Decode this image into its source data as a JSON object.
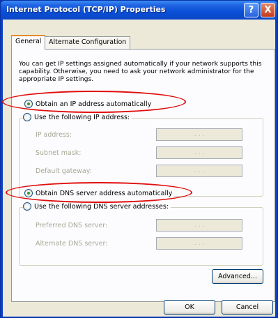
{
  "window": {
    "title": "Internet Protocol (TCP/IP) Properties",
    "help_label": "?",
    "close_label": "X"
  },
  "tabs": [
    {
      "label": "General",
      "active": true
    },
    {
      "label": "Alternate Configuration",
      "active": false
    }
  ],
  "general": {
    "description": "You can get IP settings assigned automatically if your network supports this capability. Otherwise, you need to ask your network administrator for the appropriate IP settings.",
    "ip": {
      "auto_label": "Obtain an IP address automatically",
      "auto_checked": true,
      "manual_label": "Use the following IP address:",
      "manual_checked": false,
      "fields": [
        {
          "label": "IP address:",
          "value": ". . ."
        },
        {
          "label": "Subnet mask:",
          "value": ". . ."
        },
        {
          "label": "Default gateway:",
          "value": ". . ."
        }
      ]
    },
    "dns": {
      "auto_label": "Obtain DNS server address automatically",
      "auto_checked": true,
      "manual_label": "Use the following DNS server addresses:",
      "manual_checked": false,
      "fields": [
        {
          "label": "Preferred DNS server:",
          "value": ". . ."
        },
        {
          "label": "Alternate DNS server:",
          "value": ". . ."
        }
      ]
    },
    "advanced_label": "Advanced..."
  },
  "footer": {
    "ok_label": "OK",
    "cancel_label": "Cancel"
  },
  "colors": {
    "highlight_ellipse": "#e10d0d",
    "titlebar": "#0a4fd6"
  }
}
